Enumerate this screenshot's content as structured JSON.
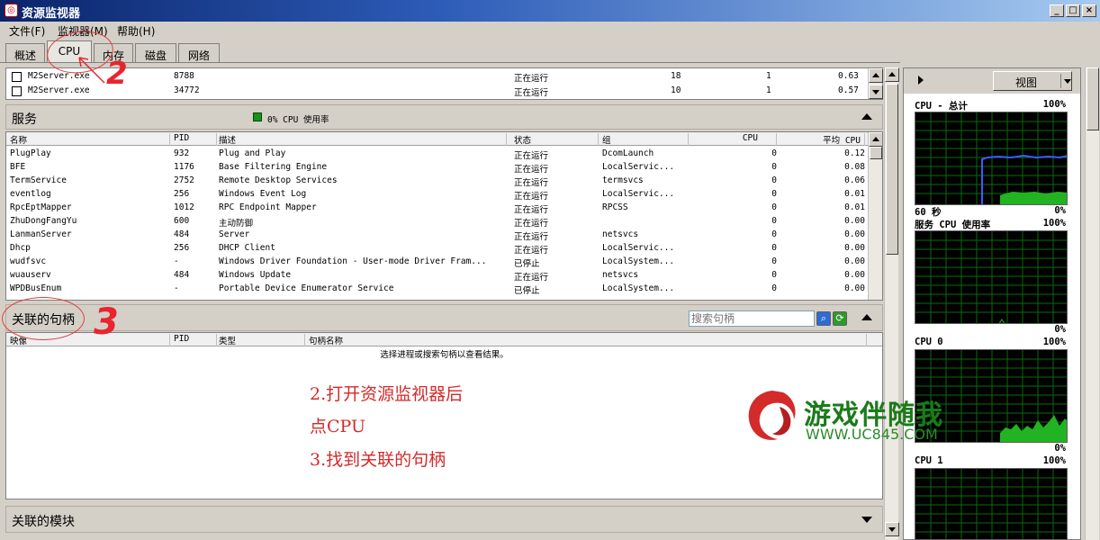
{
  "window": {
    "title": "资源监视器",
    "controls": [
      "_",
      "□",
      "×"
    ]
  },
  "menu": {
    "file": "文件(F)",
    "monitor": "监视器(M)",
    "help": "帮助(H)"
  },
  "tabs": [
    "概述",
    "CPU",
    "内存",
    "磁盘",
    "网络"
  ],
  "processes": {
    "rows": [
      {
        "name": "M2Server.exe",
        "pid": "8788",
        "status": "正在运行",
        "threads": "18",
        "cpu": "1",
        "avg": "0.63"
      },
      {
        "name": "M2Server.exe",
        "pid": "34772",
        "status": "正在运行",
        "threads": "10",
        "cpu": "1",
        "avg": "0.57"
      }
    ]
  },
  "services": {
    "title": "服务",
    "usage_label": "0% CPU 使用率",
    "columns": [
      "名称",
      "PID",
      "描述",
      "状态",
      "组",
      "CPU",
      "平均 CPU"
    ],
    "rows": [
      {
        "name": "PlugPlay",
        "pid": "932",
        "desc": "Plug and Play",
        "status": "正在运行",
        "group": "DcomLaunch",
        "cpu": "0",
        "avg": "0.12"
      },
      {
        "name": "BFE",
        "pid": "1176",
        "desc": "Base Filtering Engine",
        "status": "正在运行",
        "group": "LocalServic...",
        "cpu": "0",
        "avg": "0.08"
      },
      {
        "name": "TermService",
        "pid": "2752",
        "desc": "Remote Desktop Services",
        "status": "正在运行",
        "group": "termsvcs",
        "cpu": "0",
        "avg": "0.06"
      },
      {
        "name": "eventlog",
        "pid": "256",
        "desc": "Windows Event Log",
        "status": "正在运行",
        "group": "LocalServic...",
        "cpu": "0",
        "avg": "0.01"
      },
      {
        "name": "RpcEptMapper",
        "pid": "1012",
        "desc": "RPC Endpoint Mapper",
        "status": "正在运行",
        "group": "RPCSS",
        "cpu": "0",
        "avg": "0.01"
      },
      {
        "name": "ZhuDongFangYu",
        "pid": "600",
        "desc": "主动防御",
        "status": "正在运行",
        "group": "",
        "cpu": "0",
        "avg": "0.00"
      },
      {
        "name": "LanmanServer",
        "pid": "484",
        "desc": "Server",
        "status": "正在运行",
        "group": "netsvcs",
        "cpu": "0",
        "avg": "0.00"
      },
      {
        "name": "Dhcp",
        "pid": "256",
        "desc": "DHCP Client",
        "status": "正在运行",
        "group": "LocalServic...",
        "cpu": "0",
        "avg": "0.00"
      },
      {
        "name": "wudfsvc",
        "pid": "-",
        "desc": "Windows Driver Foundation - User-mode Driver Fram...",
        "status": "已停止",
        "group": "LocalSystem...",
        "cpu": "0",
        "avg": "0.00"
      },
      {
        "name": "wuauserv",
        "pid": "484",
        "desc": "Windows Update",
        "status": "正在运行",
        "group": "netsvcs",
        "cpu": "0",
        "avg": "0.00"
      },
      {
        "name": "WPDBusEnum",
        "pid": "-",
        "desc": "Portable Device Enumerator Service",
        "status": "已停止",
        "group": "LocalSystem...",
        "cpu": "0",
        "avg": "0.00"
      }
    ]
  },
  "handles": {
    "title": "关联的句柄",
    "search_placeholder": "搜索句柄",
    "columns": [
      "映像",
      "PID",
      "类型",
      "句柄名称"
    ],
    "empty_message": "选择进程或搜索句柄以查看结果。"
  },
  "modules": {
    "title": "关联的模块"
  },
  "right_panel": {
    "view_button": "视图",
    "graphs": [
      {
        "title": "CPU - 总计",
        "top_pct": "100%",
        "bottom_left": "60 秒",
        "bottom_pct": "0%"
      },
      {
        "title": "服务 CPU 使用率",
        "top_pct": "100%",
        "bottom_pct": "0%"
      },
      {
        "title": "CPU 0",
        "top_pct": "100%",
        "bottom_pct": "0%"
      },
      {
        "title": "CPU 1",
        "top_pct": "100%"
      }
    ]
  },
  "annotations": {
    "step2_line1": "2.打开资源监视器后",
    "step2_line2": "点CPU",
    "step3": "3.找到关联的句柄",
    "num2": "2",
    "num3": "3"
  },
  "watermark": {
    "title": "游戏伴随我",
    "url": "WWW.UC845.COM"
  },
  "colors": {
    "titlebar": "#0a246a",
    "graph_bg": "#000000",
    "graph_grid": "#008000",
    "graph_fill": "#22b322",
    "graph_line_blue": "#3b5cff",
    "annotation": "#d42a2a"
  }
}
